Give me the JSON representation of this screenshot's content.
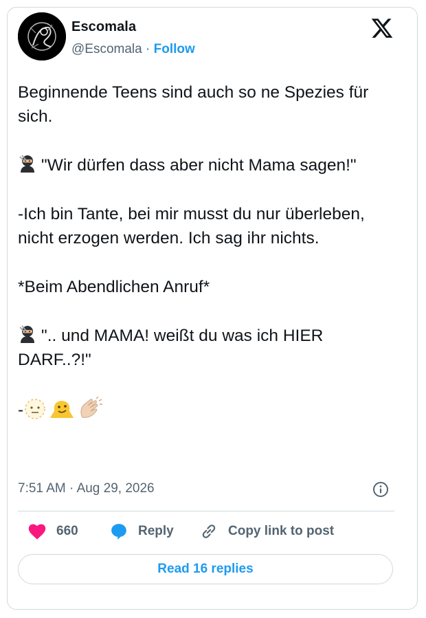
{
  "author": {
    "display_name": "Escomala",
    "handle": "@Escomala",
    "separator": "·",
    "follow_label": "Follow"
  },
  "post": {
    "lines": [
      "Beginnende Teens sind auch so ne Spezies für sich.",
      "\"Wir dürfen dass aber nicht Mama sagen!\"",
      "-Ich bin Tante, bei mir musst du nur überleben, nicht erzogen werden. Ich sag ihr nichts.",
      "*Beim Abendlichen Anruf*",
      "\".. und MAMA! weißt du was ich HIER DARF..?!\"",
      "-"
    ],
    "emoji_names": [
      "ninja-emoji",
      "dotted-line-face-emoji",
      "melting-face-emoji",
      "clapping-hands-emoji"
    ],
    "time": "7:51 AM",
    "date": "Aug 29, 2026",
    "time_separator": "·"
  },
  "actions": {
    "likes": "660",
    "reply_label": "Reply",
    "copy_label": "Copy link to post",
    "read_replies_label": "Read 16 replies"
  },
  "colors": {
    "accent": "#1d9bf0",
    "like": "#f91880",
    "secondary_text": "#536471",
    "border": "#cfd9de"
  }
}
